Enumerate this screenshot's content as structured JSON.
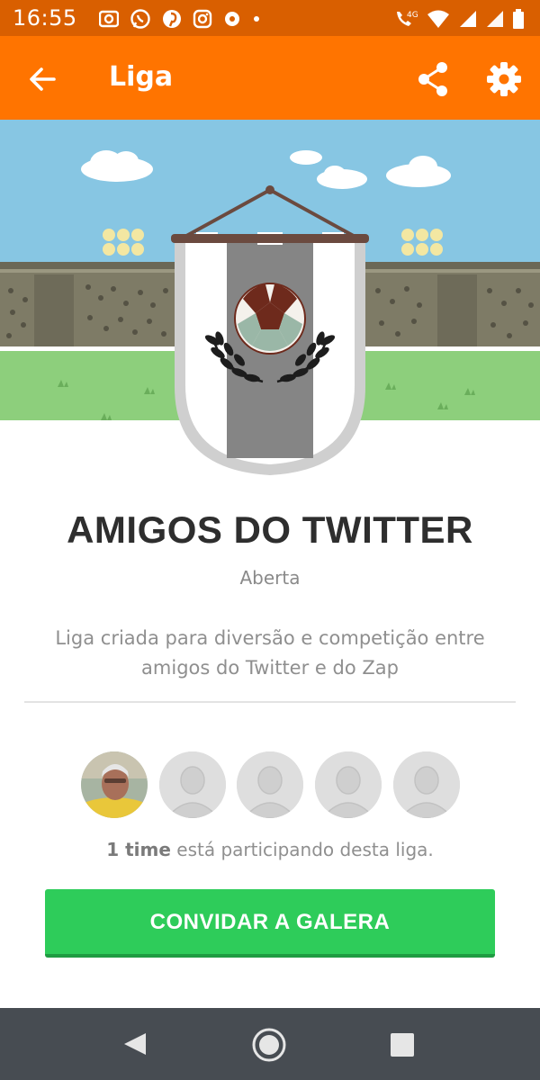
{
  "status_bar": {
    "time": "16:55",
    "network": "4G",
    "icons": [
      "photo-icon",
      "whatsapp-icon",
      "pinterest-icon",
      "instagram-icon",
      "football-icon",
      "dot-icon",
      "call-wifi-icon",
      "wifi-icon",
      "signal-icon",
      "signal-icon",
      "battery-icon"
    ]
  },
  "app_bar": {
    "title": "Liga",
    "back_icon": "arrow-left-icon",
    "share_icon": "share-icon",
    "settings_icon": "gear-icon",
    "color": "#ff7400"
  },
  "league": {
    "name": "AMIGOS DO TWITTER",
    "status": "Aberta",
    "description": "Liga criada para diversão e competição entre amigos do Twitter e do Zap"
  },
  "participants": {
    "count_text": "1 time",
    "suffix_text": " está participando desta liga.",
    "avatars": [
      "user-photo",
      "placeholder",
      "placeholder",
      "placeholder",
      "placeholder"
    ]
  },
  "invite_button": {
    "label": "CONVIDAR A GALERA",
    "color": "#2ecc5a"
  },
  "nav_bar": {
    "icons": [
      "nav-back-icon",
      "nav-home-icon",
      "nav-recent-icon"
    ]
  }
}
